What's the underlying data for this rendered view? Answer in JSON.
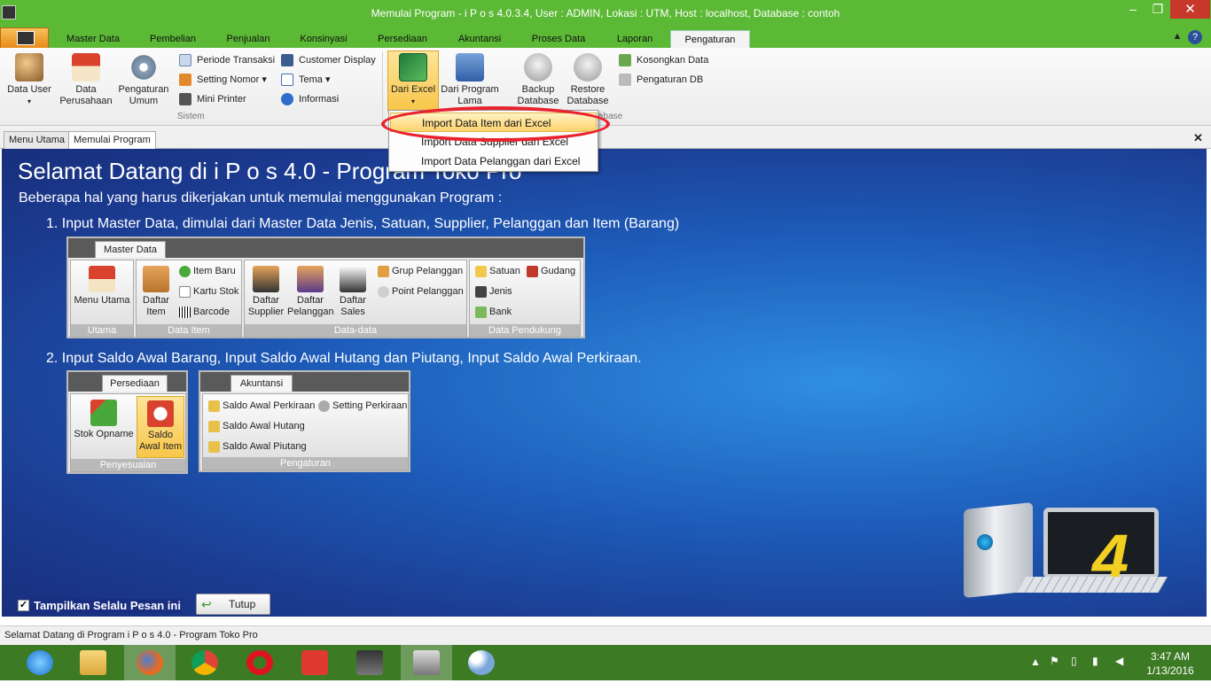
{
  "window": {
    "title": "Memulai Program - i P o s 4.0.3.4,  User : ADMIN, Lokasi : UTM, Host : localhost, Database : contoh",
    "minimize": "–",
    "maximize": "❐",
    "close": "✕"
  },
  "ribbon_tabs": [
    "Master Data",
    "Pembelian",
    "Penjualan",
    "Konsinyasi",
    "Persediaan",
    "Akuntansi",
    "Proses Data",
    "Laporan",
    "Pengaturan"
  ],
  "ribbon": {
    "data_user": "Data User",
    "data_perusahaan_1": "Data",
    "data_perusahaan_2": "Perusahaan",
    "pengaturan_umum_1": "Pengaturan",
    "pengaturan_umum_2": "Umum",
    "periode_transaksi": "Periode Transaksi",
    "setting_nomor": "Setting Nomor",
    "mini_printer": "Mini Printer",
    "customer_display": "Customer Display",
    "tema": "Tema",
    "informasi": "Informasi",
    "group_sistem": "Sistem",
    "dari_excel": "Dari Excel",
    "dari_program_lama_1": "Dari Program",
    "dari_program_lama_2": "Lama",
    "backup_1": "Backup",
    "backup_2": "Database",
    "restore_1": "Restore",
    "restore_2": "Database",
    "kosongkan_data": "Kosongkan Data",
    "pengaturan_db": "Pengaturan DB",
    "group_database": "abase"
  },
  "dropdown": [
    "Import Data Item dari Excel",
    "Import Data Supplier dari Excel",
    "Import Data Pelanggan dari Excel"
  ],
  "doc_tabs": [
    "Menu Utama",
    "Memulai Program"
  ],
  "main": {
    "title": "Selamat Datang di i P o s  4.0 - Program Toko Pro",
    "intro": "Beberapa hal yang harus dikerjakan untuk memulai menggunakan Program :",
    "step1": "1. Input Master Data, dimulai dari Master Data Jenis, Satuan, Supplier, Pelanggan dan Item (Barang)",
    "step2": "2. Input Saldo Awal Barang, Input Saldo Awal Hutang dan Piutang, Input Saldo Awal Perkiraan."
  },
  "panel1": {
    "tab": "Master Data",
    "menu_utama": "Menu Utama",
    "g_utama": "Utama",
    "daftar_item_1": "Daftar",
    "daftar_item_2": "Item",
    "item_baru": "Item Baru",
    "kartu_stok": "Kartu Stok",
    "barcode": "Barcode",
    "g_data_item": "Data Item",
    "daftar_supplier_1": "Daftar",
    "daftar_supplier_2": "Supplier",
    "daftar_pelanggan_1": "Daftar",
    "daftar_pelanggan_2": "Pelanggan",
    "daftar_sales_1": "Daftar",
    "daftar_sales_2": "Sales",
    "grup_pelanggan": "Grup Pelanggan",
    "point_pelanggan": "Point Pelanggan",
    "g_data_data": "Data-data",
    "satuan": "Satuan",
    "gudang": "Gudang",
    "jenis": "Jenis",
    "bank": "Bank",
    "g_data_pendukung": "Data Pendukung"
  },
  "panel2": {
    "tab": "Persediaan",
    "stok_opname": "Stok Opname",
    "saldo_awal_item_1": "Saldo",
    "saldo_awal_item_2": "Awal Item",
    "g_penyesuaian": "Penyesuaian"
  },
  "panel3": {
    "tab": "Akuntansi",
    "saldo_awal_perkiraan": "Saldo Awal Perkiraan",
    "setting_perkiraan": "Setting Perkiraan",
    "saldo_awal_hutang": "Saldo Awal Hutang",
    "saldo_awal_piutang": "Saldo Awal Piutang",
    "g_pengaturan": "Pengaturan"
  },
  "footer": {
    "checkbox_label": "Tampilkan Selalu Pesan ini",
    "checkbox_checked": true,
    "tutup": "Tutup"
  },
  "logo_mark": "4",
  "status_text": "Selamat Datang di Program i P o s  4.0 - Program Toko Pro",
  "taskbar": {
    "time": "3:47 AM",
    "date": "1/13/2016"
  },
  "colors": {
    "titlebar": "#5cb936",
    "taskbar": "#3d7a24",
    "highlight": "#fdd26b",
    "annotation": "#e8232e"
  }
}
